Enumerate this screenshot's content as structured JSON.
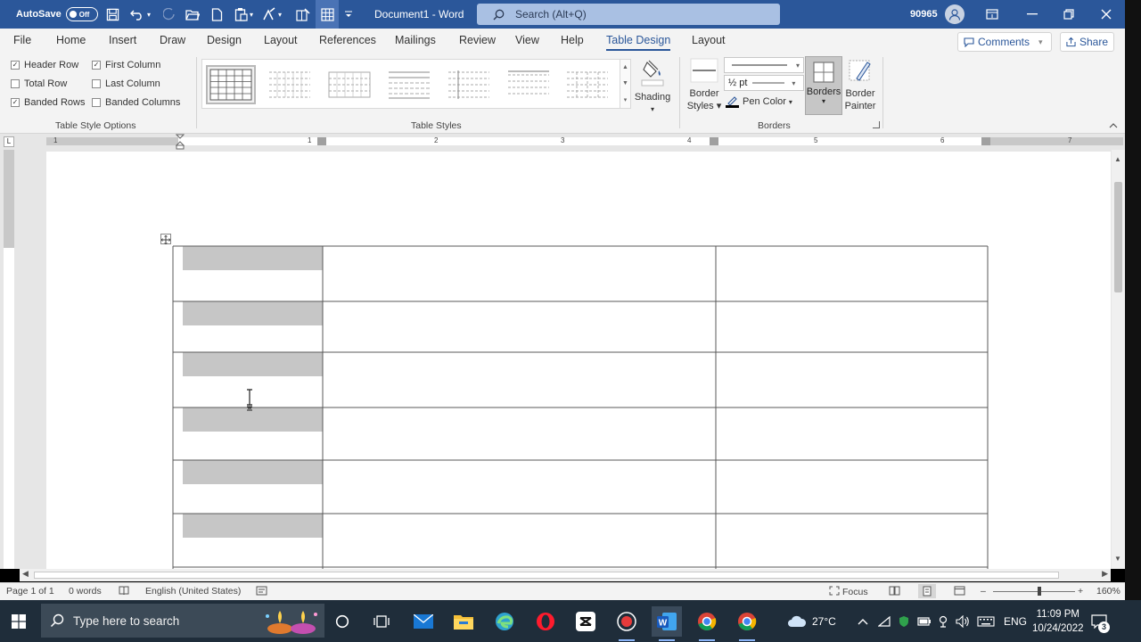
{
  "titlebar": {
    "autosave_label": "AutoSave",
    "autosave_state": "Off",
    "document_title": "Document1 - Word",
    "search_placeholder": "Search (Alt+Q)",
    "user_code": "90965"
  },
  "menu": {
    "tabs": [
      "File",
      "Home",
      "Insert",
      "Draw",
      "Design",
      "Layout",
      "References",
      "Mailings",
      "Review",
      "View",
      "Help",
      "Table Design",
      "Layout"
    ],
    "active_tab": "Table Design",
    "comments_label": "Comments",
    "share_label": "Share"
  },
  "ribbon": {
    "style_options": [
      {
        "label": "Header Row",
        "checked": true
      },
      {
        "label": "First Column",
        "checked": true
      },
      {
        "label": "Total Row",
        "checked": false
      },
      {
        "label": "Last Column",
        "checked": false
      },
      {
        "label": "Banded Rows",
        "checked": true
      },
      {
        "label": "Banded Columns",
        "checked": false
      }
    ],
    "group_style_options": "Table Style Options",
    "group_table_styles": "Table Styles",
    "group_borders": "Borders",
    "shading_label": "Shading",
    "border_styles_label_1": "Border",
    "border_styles_label_2": "Styles",
    "pen_weight": "½ pt",
    "pen_color_label": "Pen Color",
    "borders_label": "Borders",
    "border_painter_label_1": "Border",
    "border_painter_label_2": "Painter"
  },
  "ruler": {
    "numbers": [
      "1",
      "1",
      "2",
      "3",
      "4",
      "5",
      "6",
      "7"
    ]
  },
  "statusbar": {
    "page": "Page 1 of 1",
    "words": "0 words",
    "language": "English (United States)",
    "focus_label": "Focus",
    "zoom": "160%"
  },
  "taskbar": {
    "search_placeholder": "Type here to search",
    "temperature": "27°C",
    "language": "ENG",
    "time": "11:09 PM",
    "date": "10/24/2022",
    "notification_count": "3"
  },
  "colors": {
    "word_blue": "#2b579a",
    "ribbon_bg": "#f3f3f3",
    "header_band_gray": "#c6c6c6",
    "taskbar_bg": "#1f2d3a"
  }
}
